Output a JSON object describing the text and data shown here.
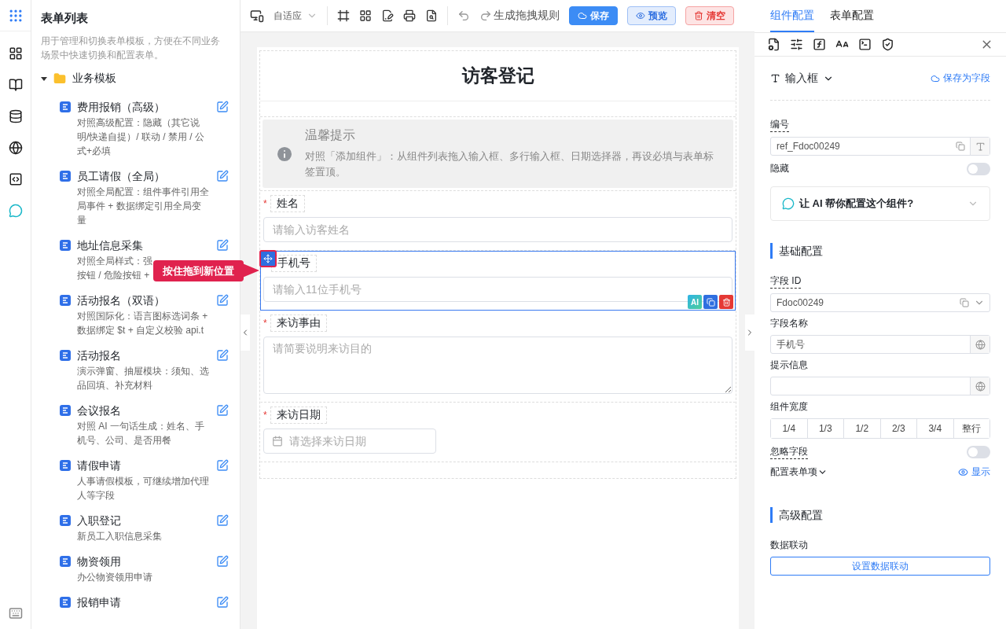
{
  "sidebar": {
    "title": "表单列表",
    "description": "用于管理和切换表单模板，方便在不同业务场景中快速切换和配置表单。",
    "folder": {
      "label": "业务模板",
      "expanded": true,
      "children": [
        {
          "title": "费用报销（高级）",
          "lines": [
            "对照高级配置：隐藏（其它说明/快递自提）/ 联动 / 禁用 / 公式+必填"
          ]
        },
        {
          "title": "员工请假（全局）",
          "lines": [
            "对照全局配置：组件事件引用全局事件 + 数据绑定引用全局变量"
          ]
        },
        {
          "title": "地址信息采集",
          "lines": [
            "对照全局样式：强",
            "按钮 / 危险按钮 +"
          ]
        },
        {
          "title": "活动报名（双语）",
          "lines": [
            "对照国际化：语言图标选词条 + 数据绑定 $t + 自定义校验 api.t"
          ]
        },
        {
          "title": "活动报名",
          "lines": [
            "演示弹窗、抽屉模块：须知、选品回填、补充材料"
          ]
        },
        {
          "title": "会议报名",
          "lines": [
            "对照 AI 一句话生成：姓名、手机号、公司、是否用餐"
          ]
        },
        {
          "title": "请假申请",
          "lines": [
            "人事请假模板，可继续增加代理人等字段"
          ]
        },
        {
          "title": "入职登记",
          "lines": [
            "新员工入职信息采集"
          ]
        },
        {
          "title": "物资领用",
          "lines": [
            "办公物资领用申请"
          ]
        },
        {
          "title": "报销申请"
        }
      ]
    }
  },
  "toolbar": {
    "device": "自适应",
    "rule": "生成拖拽规则",
    "save": "保存",
    "preview": "预览",
    "clear": "清空"
  },
  "form": {
    "title": "访客登记",
    "tip": {
      "title": "温馨提示",
      "text": "对照「添加组件」：从组件列表拖入输入框、多行输入框、日期选择器，再设必填与表单标签置顶。"
    },
    "fields": [
      {
        "kind": "input",
        "label": "姓名",
        "required": true,
        "selected": false,
        "placeholder": "请输入访客姓名"
      },
      {
        "kind": "input",
        "label": "手机号",
        "required": false,
        "selected": true,
        "placeholder": "请输入11位手机号"
      },
      {
        "kind": "textarea",
        "label": "来访事由",
        "required": true,
        "selected": false,
        "placeholder": "请简要说明来访目的"
      },
      {
        "kind": "date",
        "label": "来访日期",
        "required": true,
        "selected": false,
        "placeholder": "请选择来访日期"
      }
    ],
    "ai_label": "AI",
    "required_mark": "*",
    "drag_tip": "按住拖到新位置"
  },
  "panel": {
    "tabs": [
      {
        "label": "组件配置",
        "selected": true
      },
      {
        "label": "表单配置",
        "selected": false
      }
    ],
    "component_type": "输入框",
    "save_as_field": "保存为字段",
    "ref": {
      "label": "编号",
      "value": "ref_Fdoc00249"
    },
    "hidden": {
      "label": "隐藏",
      "on": false
    },
    "ai_prompt": "让 AI 帮你配置这个组件?",
    "basic": {
      "title": "基础配置",
      "field_id": {
        "label": "字段 ID",
        "value": "Fdoc00249"
      },
      "field_name": {
        "label": "字段名称",
        "value": "手机号"
      },
      "hint": {
        "label": "提示信息"
      },
      "width": {
        "label": "组件宽度",
        "options": [
          "1/4",
          "1/3",
          "1/2",
          "2/3",
          "3/4",
          "整行"
        ]
      },
      "ignore": {
        "label": "忽略字段",
        "on": false
      },
      "form_item": "配置表单项",
      "show": "显示"
    },
    "advanced": {
      "title": "高级配置",
      "linkage": "数据联动",
      "linkage_button": "设置数据联动"
    }
  }
}
